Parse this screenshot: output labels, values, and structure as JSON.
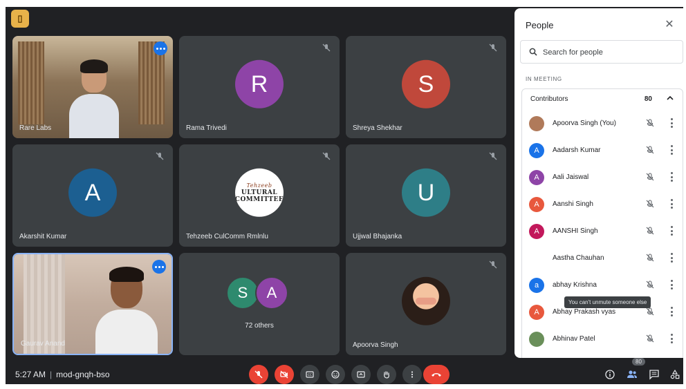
{
  "tiles": [
    {
      "name": "Rare Labs",
      "kind": "video-room"
    },
    {
      "name": "Rama Trivedi",
      "initial": "R",
      "color": "#8e44a7"
    },
    {
      "name": "Shreya Shekhar",
      "initial": "S",
      "color": "#c0483b"
    },
    {
      "name": "Akarshit Kumar",
      "initial": "A",
      "color": "#1c5f91"
    },
    {
      "name": "Tehzeeb CulComm Rmlnlu",
      "kind": "logo",
      "logo_lines": [
        "Tehzeeb",
        "ULTURAL",
        "COMMITTEE"
      ]
    },
    {
      "name": "Ujjwal Bhajanka",
      "initial": "U",
      "color": "#2e7e87"
    },
    {
      "name": "Gaurav Anand",
      "kind": "video-home"
    },
    {
      "kind": "group",
      "initials": [
        "S",
        "A"
      ],
      "colors": [
        "#2e8a6e",
        "#8e44a7"
      ],
      "others_label": "72 others"
    },
    {
      "name": "Apoorva Singh",
      "kind": "selfie"
    }
  ],
  "people_panel": {
    "title": "People",
    "search_placeholder": "Search for people",
    "section_label": "IN MEETING",
    "group_label": "Contributors",
    "group_count": "80",
    "participants": [
      {
        "name": "Apoorva Singh (You)",
        "avatar": "photo",
        "color": "#b07a5a"
      },
      {
        "name": "Aadarsh Kumar",
        "initial": "A",
        "color": "#1a73e8"
      },
      {
        "name": "Aali Jaiswal",
        "initial": "A",
        "color": "#8e44a7"
      },
      {
        "name": "Aanshi Singh",
        "initial": "A",
        "color": "#e8583d"
      },
      {
        "name": "AANSHI Singh",
        "initial": "A",
        "color": "#c2185b"
      },
      {
        "name": "Aastha Chauhan",
        "initial": "",
        "color": "#ffffff"
      },
      {
        "name": "abhay Krishna",
        "initial": "a",
        "color": "#1a73e8"
      },
      {
        "name": "Abhay Prakash vyas",
        "initial": "A",
        "color": "#e8583d"
      },
      {
        "name": "Abhinav Patel",
        "avatar": "photo",
        "color": "#6a8f5a"
      }
    ],
    "tooltip": "You can't unmute someone else"
  },
  "bottom": {
    "time": "5:27 AM",
    "meeting_code": "mod-gnqh-bso",
    "people_count": "80"
  },
  "colors": {
    "stage": "#202124",
    "tile": "#3c4043",
    "accent": "#1a73e8",
    "danger": "#ea4335"
  }
}
